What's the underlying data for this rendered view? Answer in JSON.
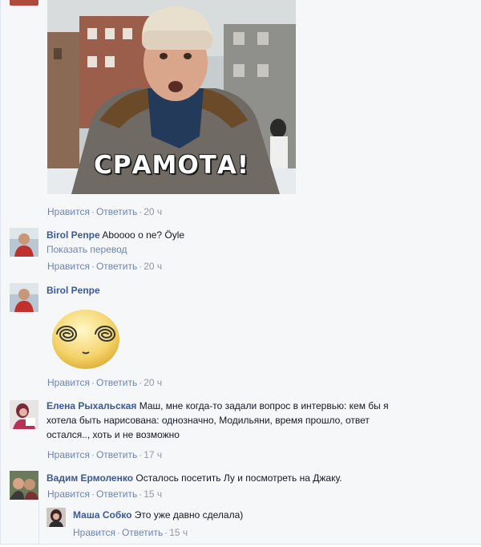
{
  "meme": {
    "caption": "СРАМОТА!"
  },
  "comments": [
    {
      "actions": {
        "like": "Нравится",
        "reply": "Ответить",
        "time": "20 ч"
      }
    },
    {
      "author": "Birol Penpe",
      "text": "Aboooo o ne? Öyle",
      "translate": "Показать перевод",
      "actions": {
        "like": "Нравится",
        "reply": "Ответить",
        "time": "20 ч"
      }
    },
    {
      "author": "Birol Penpe",
      "sticker": "dizzy-face-sticker",
      "actions": {
        "like": "Нравится",
        "reply": "Ответить",
        "time": "20 ч"
      }
    },
    {
      "author": "Елена Рыхальская",
      "text_line1": "Маш, мне когда-то задали вопрос в интервью: кем бы я",
      "text_line2": "хотела быть нарисована: однозначно, Модильяни, время прошло, ответ",
      "text_line3": "остался.., хоть и не возможно",
      "actions": {
        "like": "Нравится",
        "reply": "Ответить",
        "time": "17 ч"
      }
    },
    {
      "author": "Вадим Ермоленко",
      "text": "Осталось посетить Лу и посмотреть на Джаку.",
      "actions": {
        "like": "Нравится",
        "reply": "Ответить",
        "time": "15 ч"
      }
    },
    {
      "author": "Маша Собко",
      "text": "Это уже давно сделала)",
      "actions": {
        "like": "Нравится",
        "reply": "Ответить",
        "time": "15 ч"
      }
    }
  ],
  "separator": "·",
  "colors": {
    "link": "#3b5998",
    "action": "#6d84b4",
    "meta": "#9197a3",
    "background": "#f6f7f9"
  }
}
